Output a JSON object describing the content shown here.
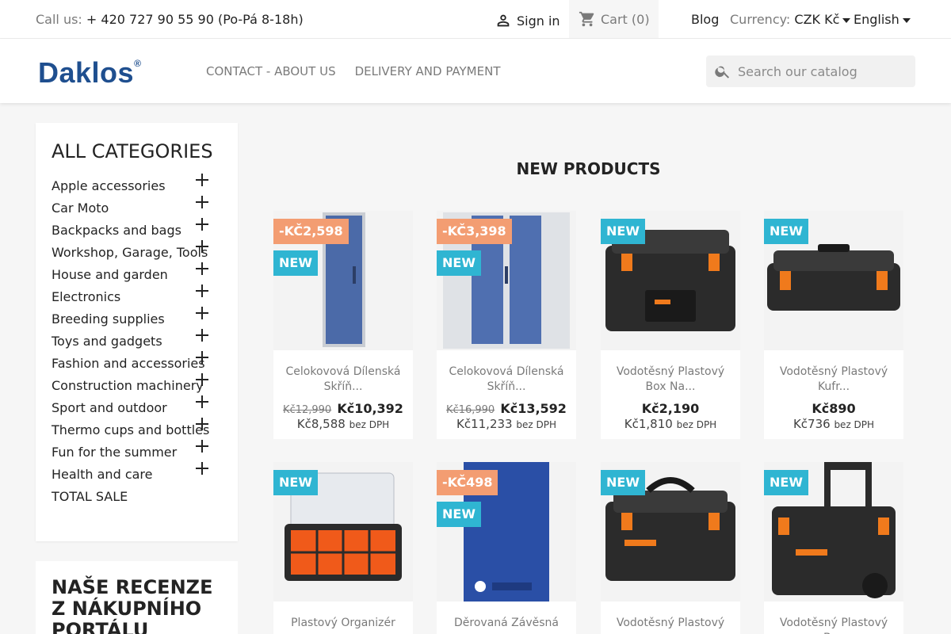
{
  "topbar": {
    "call_label": "Call us:",
    "phone": "+ 420 727 90 55 90 (Po-Pá 8-18h)",
    "signin": "Sign in",
    "cart_label": "Cart",
    "cart_count": "(0)",
    "blog": "Blog",
    "currency_label": "Currency:",
    "currency_value": "CZK Kč",
    "language": "English"
  },
  "header": {
    "logo_text": "Daklos",
    "logo_mark": "®",
    "nav": [
      "CONTACT - ABOUT US",
      "DELIVERY AND PAYMENT"
    ],
    "search_placeholder": "Search our catalog"
  },
  "categories": {
    "title": "ALL CATEGORIES",
    "items": [
      "Apple accessories",
      "Car Moto",
      "Backpacks and bags",
      "Workshop, Garage, Tools",
      "House and garden",
      "Electronics",
      "Breeding supplies",
      "Toys and gadgets",
      "Fashion and accessories",
      "Construction machinery",
      "Sport and outdoor",
      "Thermo cups and bottles",
      "Fun for the summer",
      "Health and care",
      "TOTAL SALE"
    ]
  },
  "reviews": {
    "title": "NAŠE RECENZE Z NÁKUPNÍHO PORTÁLU"
  },
  "new_products": {
    "title": "NEW PRODUCTS",
    "items": [
      {
        "name": "Celokovová Dílenská Skříň...",
        "discount": "-KČ2,598",
        "flag_new": "NEW",
        "old_price": "Kč12,990",
        "price": "Kč10,392",
        "price_ex": "Kč8,588",
        "tax_label": "bez DPH"
      },
      {
        "name": "Celokovová Dílenská Skříň...",
        "discount": "-KČ3,398",
        "flag_new": "NEW",
        "old_price": "Kč16,990",
        "price": "Kč13,592",
        "price_ex": "Kč11,233",
        "tax_label": "bez DPH"
      },
      {
        "name": "Vodotěsný Plastový Box Na...",
        "flag_new": "NEW",
        "price": "Kč2,190",
        "price_ex": "Kč1,810",
        "tax_label": "bez DPH"
      },
      {
        "name": "Vodotěsný Plastový Kufr...",
        "flag_new": "NEW",
        "price": "Kč890",
        "price_ex": "Kč736",
        "tax_label": "bez DPH"
      },
      {
        "name": "Plastový Organizér",
        "flag_new": "NEW"
      },
      {
        "name": "Děrovaná Závěsná",
        "discount": "-KČ498",
        "flag_new": "NEW"
      },
      {
        "name": "Vodotěsný Plastový",
        "flag_new": "NEW"
      },
      {
        "name": "Vodotěsný Plastový Box",
        "flag_new": "NEW"
      }
    ]
  },
  "colors": {
    "flag_new": "#2fb5d2",
    "flag_discount": "#f39d72",
    "brand_blue": "#1f4f8f"
  }
}
